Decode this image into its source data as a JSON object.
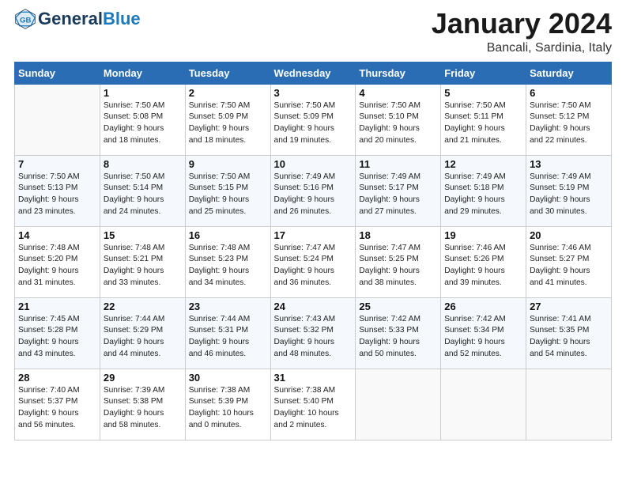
{
  "header": {
    "logo_general": "General",
    "logo_blue": "Blue",
    "month": "January 2024",
    "location": "Bancali, Sardinia, Italy"
  },
  "days_of_week": [
    "Sunday",
    "Monday",
    "Tuesday",
    "Wednesday",
    "Thursday",
    "Friday",
    "Saturday"
  ],
  "weeks": [
    [
      {
        "day": "",
        "info": ""
      },
      {
        "day": "1",
        "info": "Sunrise: 7:50 AM\nSunset: 5:08 PM\nDaylight: 9 hours\nand 18 minutes."
      },
      {
        "day": "2",
        "info": "Sunrise: 7:50 AM\nSunset: 5:09 PM\nDaylight: 9 hours\nand 18 minutes."
      },
      {
        "day": "3",
        "info": "Sunrise: 7:50 AM\nSunset: 5:09 PM\nDaylight: 9 hours\nand 19 minutes."
      },
      {
        "day": "4",
        "info": "Sunrise: 7:50 AM\nSunset: 5:10 PM\nDaylight: 9 hours\nand 20 minutes."
      },
      {
        "day": "5",
        "info": "Sunrise: 7:50 AM\nSunset: 5:11 PM\nDaylight: 9 hours\nand 21 minutes."
      },
      {
        "day": "6",
        "info": "Sunrise: 7:50 AM\nSunset: 5:12 PM\nDaylight: 9 hours\nand 22 minutes."
      }
    ],
    [
      {
        "day": "7",
        "info": "Sunrise: 7:50 AM\nSunset: 5:13 PM\nDaylight: 9 hours\nand 23 minutes."
      },
      {
        "day": "8",
        "info": "Sunrise: 7:50 AM\nSunset: 5:14 PM\nDaylight: 9 hours\nand 24 minutes."
      },
      {
        "day": "9",
        "info": "Sunrise: 7:50 AM\nSunset: 5:15 PM\nDaylight: 9 hours\nand 25 minutes."
      },
      {
        "day": "10",
        "info": "Sunrise: 7:49 AM\nSunset: 5:16 PM\nDaylight: 9 hours\nand 26 minutes."
      },
      {
        "day": "11",
        "info": "Sunrise: 7:49 AM\nSunset: 5:17 PM\nDaylight: 9 hours\nand 27 minutes."
      },
      {
        "day": "12",
        "info": "Sunrise: 7:49 AM\nSunset: 5:18 PM\nDaylight: 9 hours\nand 29 minutes."
      },
      {
        "day": "13",
        "info": "Sunrise: 7:49 AM\nSunset: 5:19 PM\nDaylight: 9 hours\nand 30 minutes."
      }
    ],
    [
      {
        "day": "14",
        "info": "Sunrise: 7:48 AM\nSunset: 5:20 PM\nDaylight: 9 hours\nand 31 minutes."
      },
      {
        "day": "15",
        "info": "Sunrise: 7:48 AM\nSunset: 5:21 PM\nDaylight: 9 hours\nand 33 minutes."
      },
      {
        "day": "16",
        "info": "Sunrise: 7:48 AM\nSunset: 5:23 PM\nDaylight: 9 hours\nand 34 minutes."
      },
      {
        "day": "17",
        "info": "Sunrise: 7:47 AM\nSunset: 5:24 PM\nDaylight: 9 hours\nand 36 minutes."
      },
      {
        "day": "18",
        "info": "Sunrise: 7:47 AM\nSunset: 5:25 PM\nDaylight: 9 hours\nand 38 minutes."
      },
      {
        "day": "19",
        "info": "Sunrise: 7:46 AM\nSunset: 5:26 PM\nDaylight: 9 hours\nand 39 minutes."
      },
      {
        "day": "20",
        "info": "Sunrise: 7:46 AM\nSunset: 5:27 PM\nDaylight: 9 hours\nand 41 minutes."
      }
    ],
    [
      {
        "day": "21",
        "info": "Sunrise: 7:45 AM\nSunset: 5:28 PM\nDaylight: 9 hours\nand 43 minutes."
      },
      {
        "day": "22",
        "info": "Sunrise: 7:44 AM\nSunset: 5:29 PM\nDaylight: 9 hours\nand 44 minutes."
      },
      {
        "day": "23",
        "info": "Sunrise: 7:44 AM\nSunset: 5:31 PM\nDaylight: 9 hours\nand 46 minutes."
      },
      {
        "day": "24",
        "info": "Sunrise: 7:43 AM\nSunset: 5:32 PM\nDaylight: 9 hours\nand 48 minutes."
      },
      {
        "day": "25",
        "info": "Sunrise: 7:42 AM\nSunset: 5:33 PM\nDaylight: 9 hours\nand 50 minutes."
      },
      {
        "day": "26",
        "info": "Sunrise: 7:42 AM\nSunset: 5:34 PM\nDaylight: 9 hours\nand 52 minutes."
      },
      {
        "day": "27",
        "info": "Sunrise: 7:41 AM\nSunset: 5:35 PM\nDaylight: 9 hours\nand 54 minutes."
      }
    ],
    [
      {
        "day": "28",
        "info": "Sunrise: 7:40 AM\nSunset: 5:37 PM\nDaylight: 9 hours\nand 56 minutes."
      },
      {
        "day": "29",
        "info": "Sunrise: 7:39 AM\nSunset: 5:38 PM\nDaylight: 9 hours\nand 58 minutes."
      },
      {
        "day": "30",
        "info": "Sunrise: 7:38 AM\nSunset: 5:39 PM\nDaylight: 10 hours\nand 0 minutes."
      },
      {
        "day": "31",
        "info": "Sunrise: 7:38 AM\nSunset: 5:40 PM\nDaylight: 10 hours\nand 2 minutes."
      },
      {
        "day": "",
        "info": ""
      },
      {
        "day": "",
        "info": ""
      },
      {
        "day": "",
        "info": ""
      }
    ]
  ]
}
